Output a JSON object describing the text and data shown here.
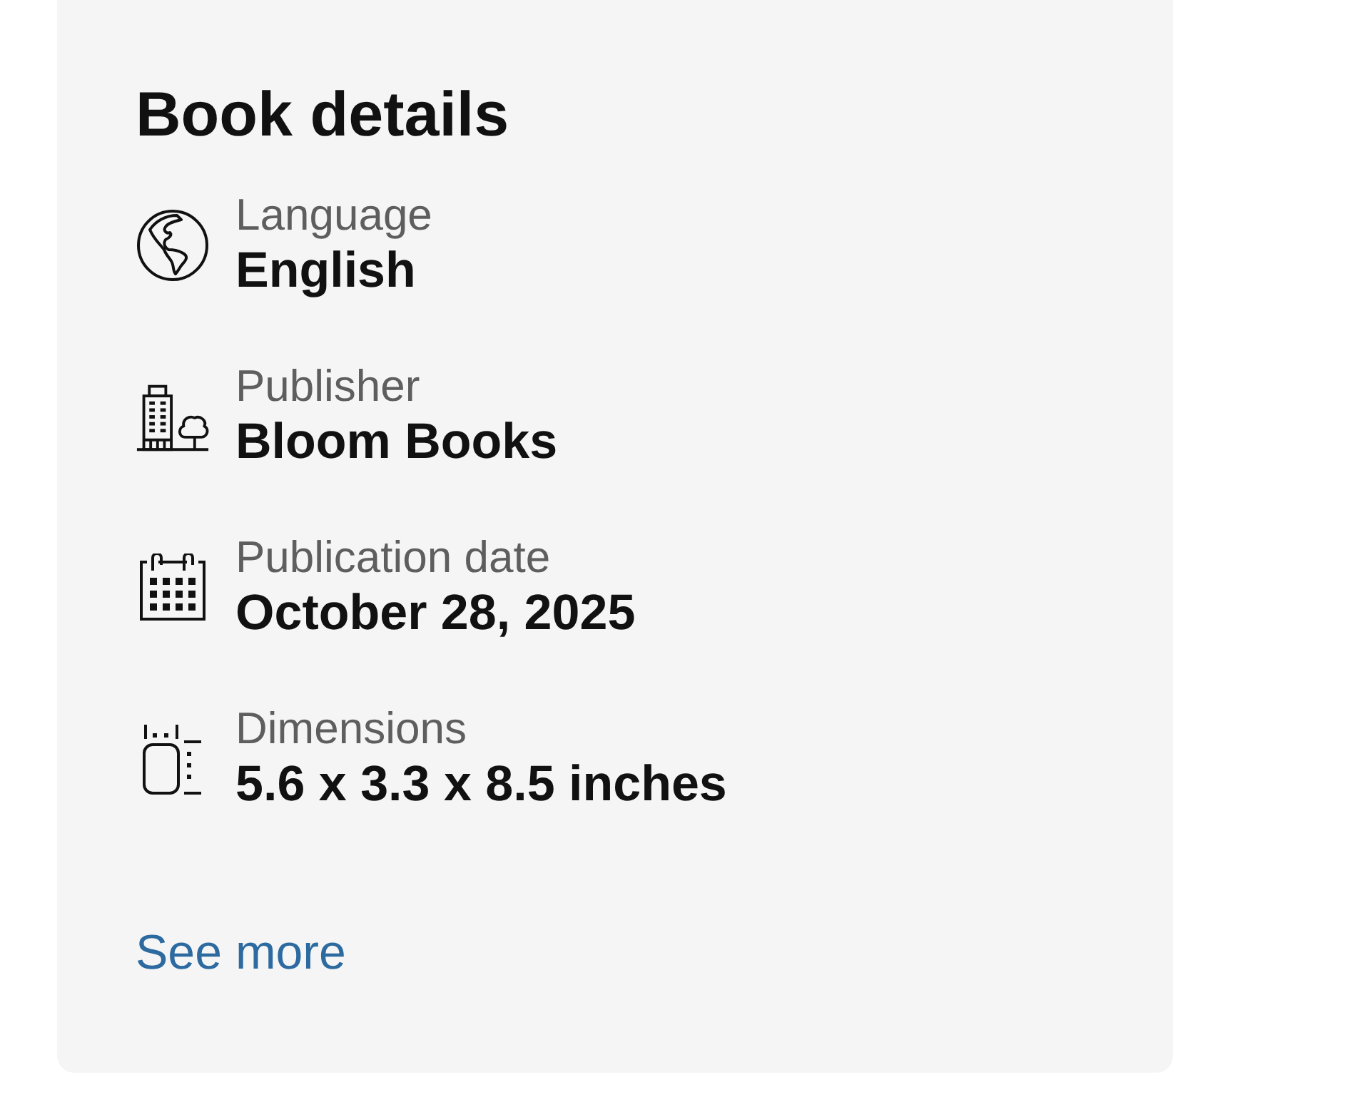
{
  "details": {
    "title": "Book details",
    "items": [
      {
        "kind": "language",
        "label": "Language",
        "value": "English"
      },
      {
        "kind": "publisher",
        "label": "Publisher",
        "value": "Bloom Books"
      },
      {
        "kind": "date",
        "label": "Publication date",
        "value": "October 28, 2025"
      },
      {
        "kind": "dimensions",
        "label": "Dimensions",
        "value": "5.6 x 3.3 x 8.5 inches"
      }
    ],
    "see_more": "See more"
  }
}
